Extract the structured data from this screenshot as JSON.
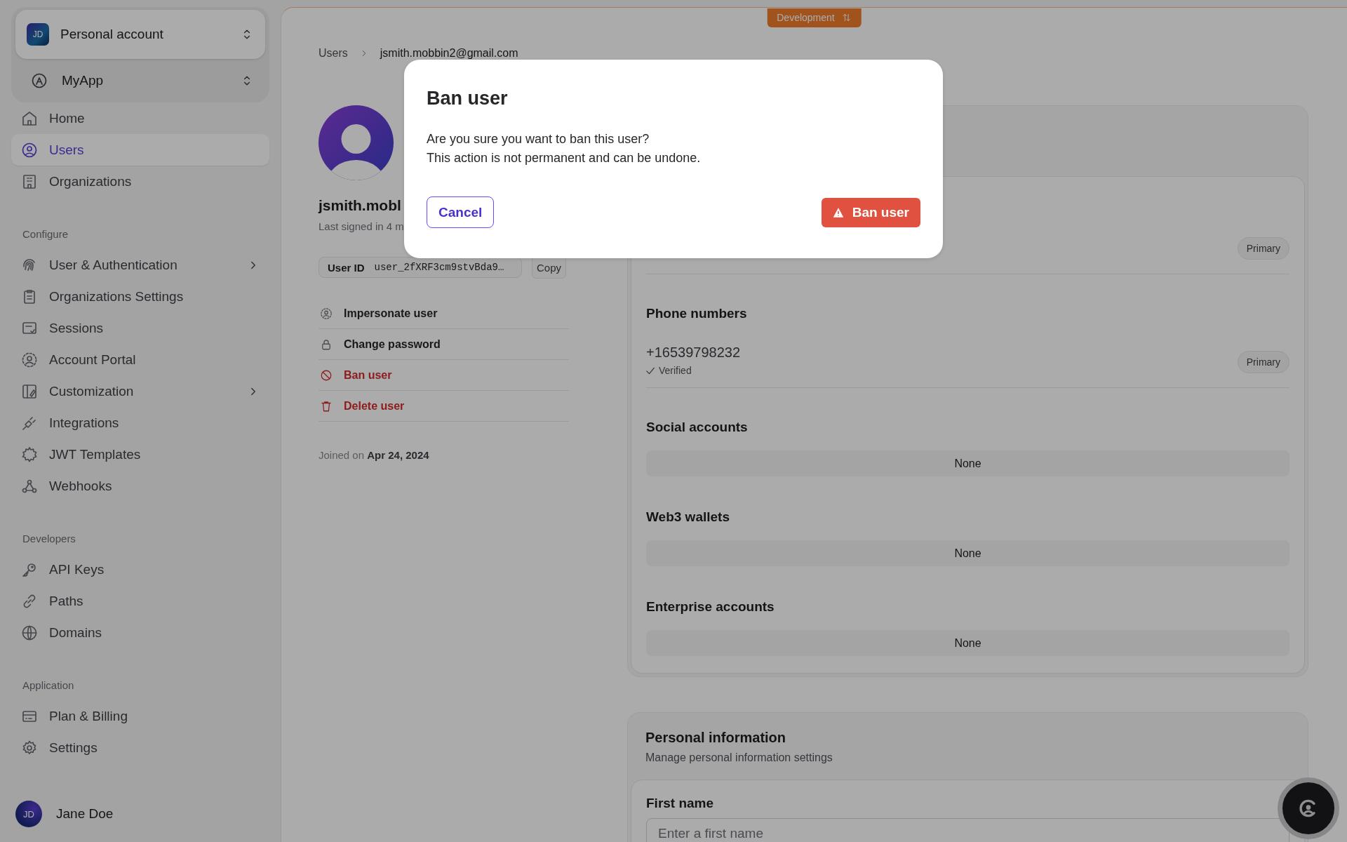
{
  "sidebar": {
    "account_switcher": {
      "initials": "JD",
      "label": "Personal account"
    },
    "app_switcher": {
      "label": "MyApp"
    },
    "sections": [
      {
        "items": [
          {
            "label": "Home",
            "selected": false,
            "has_submenu": false
          },
          {
            "label": "Users",
            "selected": true,
            "has_submenu": false
          },
          {
            "label": "Organizations",
            "selected": false,
            "has_submenu": false
          }
        ]
      },
      {
        "title": "Configure",
        "items": [
          {
            "label": "User & Authentication",
            "selected": false,
            "has_submenu": true
          },
          {
            "label": "Organizations Settings",
            "selected": false,
            "has_submenu": false
          },
          {
            "label": "Sessions",
            "selected": false,
            "has_submenu": false
          },
          {
            "label": "Account Portal",
            "selected": false,
            "has_submenu": false
          },
          {
            "label": "Customization",
            "selected": false,
            "has_submenu": true
          },
          {
            "label": "Integrations",
            "selected": false,
            "has_submenu": false
          },
          {
            "label": "JWT Templates",
            "selected": false,
            "has_submenu": false
          },
          {
            "label": "Webhooks",
            "selected": false,
            "has_submenu": false
          }
        ]
      },
      {
        "title": "Developers",
        "items": [
          {
            "label": "API Keys",
            "selected": false,
            "has_submenu": false
          },
          {
            "label": "Paths",
            "selected": false,
            "has_submenu": false
          },
          {
            "label": "Domains",
            "selected": false,
            "has_submenu": false
          }
        ]
      },
      {
        "title": "Application",
        "items": [
          {
            "label": "Plan & Billing",
            "selected": false,
            "has_submenu": false
          },
          {
            "label": "Settings",
            "selected": false,
            "has_submenu": false
          }
        ]
      }
    ],
    "user": {
      "initials": "JD",
      "name": "Jane Doe"
    }
  },
  "environment_badge": {
    "label": "Development"
  },
  "breadcrumb": [
    {
      "label": "Users"
    },
    {
      "label": "jsmith.mobbin2@gmail.com"
    }
  ],
  "profile": {
    "name": "jsmith.mobl",
    "last_signed_in": "Last signed in 4 m",
    "user_id_label": "User ID",
    "user_id": "user_2fXRF3cm9stvBda9…",
    "copy_button": "Copy",
    "actions": [
      {
        "label": "Impersonate user",
        "danger": false
      },
      {
        "label": "Change password",
        "danger": false
      },
      {
        "label": "Ban user",
        "danger": true
      },
      {
        "label": "Delete user",
        "danger": true
      }
    ],
    "joined_label": "Joined on",
    "joined_date": "Apr 24, 2024"
  },
  "identifiers": [
    {
      "kind": "list",
      "items": [
        {
          "badge": "Primary"
        }
      ]
    },
    {
      "kind": "list",
      "title": "Phone numbers",
      "items": [
        {
          "value": "+16539798232",
          "status": "Verified",
          "badge": "Primary"
        }
      ]
    },
    {
      "kind": "empty",
      "title": "Social accounts",
      "empty": "None"
    },
    {
      "kind": "empty",
      "title": "Web3 wallets",
      "empty": "None"
    },
    {
      "kind": "empty",
      "title": "Enterprise accounts",
      "empty": "None"
    }
  ],
  "personal_information": {
    "title": "Personal information",
    "subtitle": "Manage personal information settings",
    "fields": [
      {
        "label": "First name",
        "placeholder": "Enter a first name"
      }
    ]
  },
  "modal": {
    "title": "Ban user",
    "lines": [
      "Are you sure you want to ban this user?",
      "This action is not permanent and can be undone."
    ],
    "cancel": "Cancel",
    "confirm": "Ban user"
  }
}
